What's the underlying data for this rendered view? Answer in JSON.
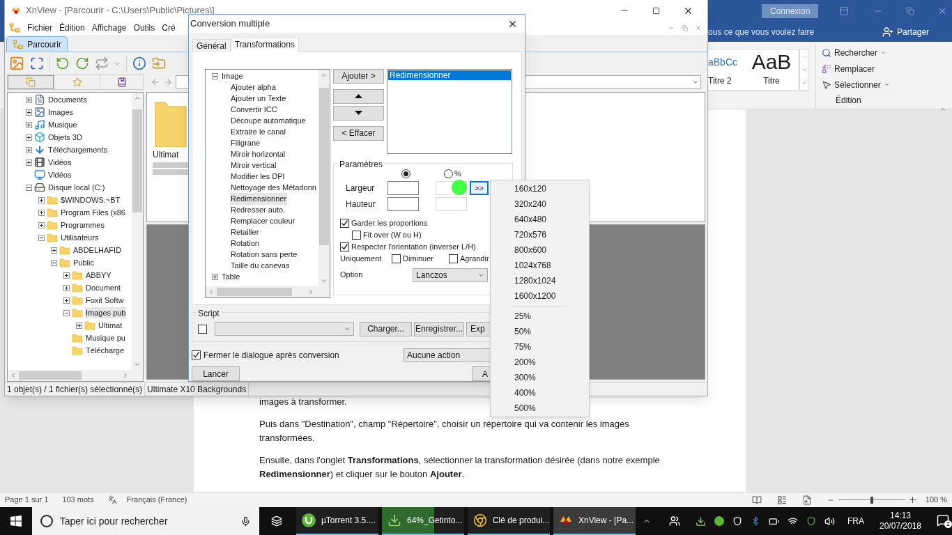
{
  "word": {
    "connexion": "Connexion",
    "tell_me": "ous ce que vous voulez faire",
    "share": "Partager",
    "styles": [
      {
        "preview": "aBbCc",
        "name": "Titre 2",
        "kind": "heading2"
      },
      {
        "preview": "AaB",
        "name": "Titre",
        "kind": "title"
      }
    ],
    "editing": [
      {
        "kind": "find",
        "label": "Rechercher"
      },
      {
        "kind": "replace",
        "label": "Remplacer"
      },
      {
        "kind": "select",
        "label": "Sélectionner"
      }
    ],
    "editing_group": "Édition",
    "paragraphs": [
      "images à transformer.",
      "Puis dans \"Destination\",  champ \"Répertoire\", choisir un répertoire qui va contenir les images transformées.",
      "Ensuite, dans l'onglet **Transformations**, sélectionner la transformation désirée (dans notre exemple **Redimensionner**) et cliquer sur le bouton **Ajouter**."
    ],
    "status": {
      "page": "Page 1 sur 1",
      "words": "103 mots",
      "language": "Français (France)",
      "zoom": "100 %",
      "level": 0.5
    }
  },
  "xnview": {
    "title": "XnView - [Parcourir - C:\\Users\\Public\\Pictures\\]",
    "menu": [
      "Fichier",
      "Édition",
      "Affichage",
      "Outils",
      "Cré"
    ],
    "tab": "Parcourir",
    "tree": [
      {
        "label": "Documents",
        "kind": "document",
        "expanded": false,
        "selected": false
      },
      {
        "label": "Images",
        "kind": "image",
        "expanded": false,
        "selected": false
      },
      {
        "label": "Musique",
        "kind": "music",
        "expanded": false,
        "selected": false
      },
      {
        "label": "Objets 3D",
        "kind": "cube",
        "expanded": false,
        "selected": false
      },
      {
        "label": "Téléchargements",
        "kind": "download",
        "expanded": false,
        "selected": false
      },
      {
        "label": "Vidéos",
        "kind": "film",
        "expanded": false,
        "selected": false
      },
      {
        "label": "Vidéos",
        "kind": "desktop",
        "selected": false
      },
      {
        "label": "Disque local (C:)",
        "kind": "drive",
        "expanded": true,
        "selected": false,
        "children": [
          {
            "label": "$WINDOWS.~BT",
            "kind": "folder",
            "expanded": false,
            "selected": false
          },
          {
            "label": "Program Files (x86",
            "kind": "folder",
            "expanded": false,
            "selected": false
          },
          {
            "label": "Programmes",
            "kind": "folder",
            "expanded": false,
            "selected": false
          },
          {
            "label": "Utilisateurs",
            "kind": "folder",
            "expanded": true,
            "selected": false,
            "children": [
              {
                "label": "ABDELHAFID",
                "kind": "folder",
                "expanded": false,
                "selected": false
              },
              {
                "label": "Public",
                "kind": "folder",
                "expanded": true,
                "selected": false,
                "children": [
                  {
                    "label": "ABBYY",
                    "kind": "folder",
                    "expanded": false,
                    "selected": false
                  },
                  {
                    "label": "Document",
                    "kind": "folder",
                    "expanded": false,
                    "selected": false
                  },
                  {
                    "label": "Foxit Softw",
                    "kind": "folder",
                    "expanded": false,
                    "selected": false
                  },
                  {
                    "label": "Images pub",
                    "kind": "folder",
                    "expanded": true,
                    "selected": true,
                    "children": [
                      {
                        "label": "Ultimat",
                        "kind": "folder",
                        "expanded": false,
                        "selected": false
                      }
                    ]
                  },
                  {
                    "label": "Musique pu",
                    "kind": "folder",
                    "selected": false
                  },
                  {
                    "label": "Télécharge",
                    "kind": "folder",
                    "selected": false
                  }
                ]
              }
            ]
          }
        ]
      }
    ],
    "thumbnail": "Ultimat",
    "status": [
      "1 objet(s) / 1 fichier(s) sélectionné(s)",
      "Ultimate X10 Backgrounds"
    ]
  },
  "dialog": {
    "title": "Conversion multiple",
    "tabs": [
      {
        "label": "Général",
        "selected": false
      },
      {
        "label": "Transformations",
        "selected": true
      }
    ],
    "tree": [
      {
        "label": "Image",
        "expanded": true,
        "children": [
          {
            "label": "Ajouter alpha",
            "selected": false
          },
          {
            "label": "Ajouter un Texte",
            "selected": false
          },
          {
            "label": "Convertir ICC",
            "selected": false
          },
          {
            "label": "Découpe automatique",
            "selected": false
          },
          {
            "label": "Extraire le canal",
            "selected": false
          },
          {
            "label": "Filigrane",
            "selected": false
          },
          {
            "label": "Miroir horizontal",
            "selected": false
          },
          {
            "label": "Miroir vertical",
            "selected": false
          },
          {
            "label": "Modifier les DPI",
            "selected": false
          },
          {
            "label": "Nettoyage des Métadonn",
            "selected": false
          },
          {
            "label": "Redimensionner",
            "selected": true
          },
          {
            "label": "Redresser auto.",
            "selected": false
          },
          {
            "label": "Remplacer couleur",
            "selected": false
          },
          {
            "label": "Retailler",
            "selected": false
          },
          {
            "label": "Rotation",
            "selected": false
          },
          {
            "label": "Rotation sans perte",
            "selected": false
          },
          {
            "label": "Taille du canevas",
            "selected": false
          }
        ]
      },
      {
        "label": "Table",
        "expanded": false
      }
    ],
    "add": "Ajouter >",
    "remove": "< Effacer",
    "applied": [
      {
        "label": "Redimensionner",
        "selected": true
      }
    ],
    "params": {
      "title": "Paramètres",
      "radios": [
        {
          "selected": true
        },
        {
          "label": "%",
          "selected": false
        }
      ],
      "width": "Largeur",
      "height": "Hauteur",
      "presets": ">>",
      "checks": [
        {
          "label": "Garder les proportions",
          "checked": true,
          "children": [
            {
              "label": "Fit over (W ou H)",
              "checked": false
            }
          ]
        },
        {
          "label": "Respecter l'orientation (inverser L/H)",
          "checked": true
        }
      ],
      "only": {
        "label": "Uniquement",
        "options": [
          {
            "label": "Diminuer",
            "checked": false
          },
          {
            "label": "Agrandir",
            "checked": false
          }
        ]
      },
      "option": {
        "label": "Option",
        "value": "Lanczos"
      }
    },
    "script": {
      "title": "Script",
      "checked": false,
      "buttons": [
        "Charger...",
        "Enregistrer...",
        "Exp"
      ]
    },
    "close_after": {
      "label": "Fermer le dialogue après conversion",
      "checked": true
    },
    "after_action": "Aucune action",
    "run": "Lancer",
    "cancel": "A"
  },
  "preset_menu": {
    "sizes": [
      "160x120",
      "320x240",
      "640x480",
      "720x576",
      "800x600",
      "1024x768",
      "1280x1024",
      "1600x1200"
    ],
    "percents": [
      "25%",
      "50%",
      "75%",
      "200%",
      "300%",
      "400%",
      "500%"
    ]
  },
  "taskbar": {
    "search": "Taper ici pour rechercher",
    "apps": [
      {
        "label": "µTorrent 3.5....",
        "kind": "utorrent",
        "active": false
      },
      {
        "label": "64%_Getinto...",
        "kind": "download",
        "active": false,
        "level": 0.64
      },
      {
        "label": "Clé de produi...",
        "kind": "chrome",
        "active": false
      },
      {
        "label": "XnView - [Pa...",
        "kind": "xnview",
        "active": true
      }
    ],
    "lang": "FRA",
    "time": "14:13",
    "date": "20/07/2018",
    "notifications": "2"
  }
}
